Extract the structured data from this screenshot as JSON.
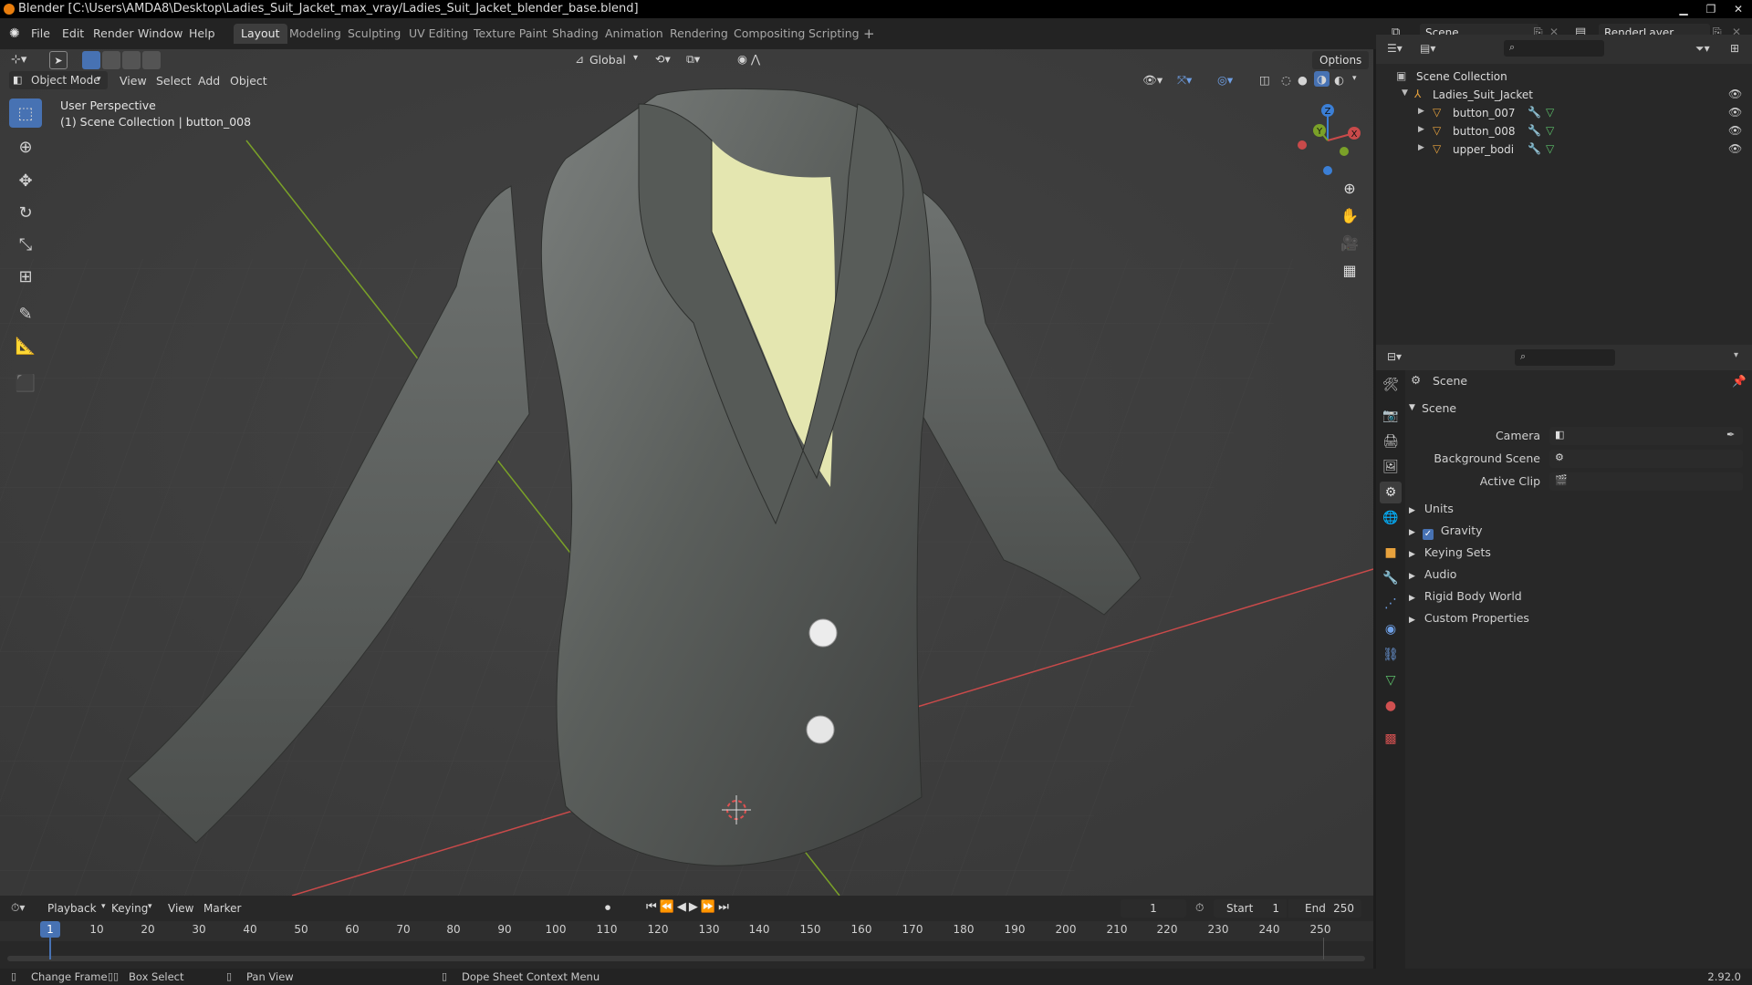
{
  "window": {
    "title": "Blender [C:\\Users\\AMDA8\\Desktop\\Ladies_Suit_Jacket_max_vray/Ladies_Suit_Jacket_blender_base.blend]"
  },
  "menu": {
    "items": [
      "File",
      "Edit",
      "Render",
      "Window",
      "Help"
    ]
  },
  "workspaces": [
    "Layout",
    "Modeling",
    "Sculpting",
    "UV Editing",
    "Texture Paint",
    "Shading",
    "Animation",
    "Rendering",
    "Compositing",
    "Scripting"
  ],
  "active_workspace": "Layout",
  "scene_selector": {
    "scene": "Scene",
    "render_layer": "RenderLayer"
  },
  "viewport_header": {
    "transform_orientation": "Global",
    "options_label": "Options",
    "mode": "Object Mode",
    "menus": [
      "View",
      "Select",
      "Add",
      "Object"
    ]
  },
  "viewport_overlay": {
    "line1": "User Perspective",
    "line2": "(1) Scene Collection | button_008"
  },
  "gizmo": {
    "z": "Z",
    "y": "Y",
    "x": "X"
  },
  "outliner": {
    "root": "Scene Collection",
    "collection": "Ladies_Suit_Jacket",
    "objects": [
      "button_007",
      "button_008",
      "upper_bodi"
    ]
  },
  "properties": {
    "context_title": "Scene",
    "panel_title": "Scene",
    "fields": [
      {
        "label": "Camera",
        "value": ""
      },
      {
        "label": "Background Scene",
        "value": ""
      },
      {
        "label": "Active Clip",
        "value": ""
      }
    ],
    "sections": [
      {
        "label": "Units",
        "checkbox": false
      },
      {
        "label": "Gravity",
        "checkbox": true
      },
      {
        "label": "Keying Sets",
        "checkbox": false
      },
      {
        "label": "Audio",
        "checkbox": false
      },
      {
        "label": "Rigid Body World",
        "checkbox": false
      },
      {
        "label": "Custom Properties",
        "checkbox": false
      }
    ]
  },
  "timeline": {
    "menus": [
      "Playback",
      "Keying",
      "View",
      "Marker"
    ],
    "current_frame": "1",
    "start_label": "Start",
    "start": "1",
    "end_label": "End",
    "end": "250",
    "ticks": [
      "1",
      "10",
      "20",
      "30",
      "40",
      "50",
      "60",
      "70",
      "80",
      "90",
      "100",
      "110",
      "120",
      "130",
      "140",
      "150",
      "160",
      "170",
      "180",
      "190",
      "200",
      "210",
      "220",
      "230",
      "240",
      "250"
    ]
  },
  "statusbar": {
    "change_frame": "Change Frame",
    "box_select": "Box Select",
    "pan_view": "Pan View",
    "context_menu": "Dope Sheet Context Menu",
    "version": "2.92.0"
  },
  "colors": {
    "accent": "#4772b3",
    "x_axis": "#c94a4a",
    "y_axis": "#7aa128",
    "z_axis": "#3b7fd6",
    "jacket": "#5f625f",
    "top": "#e4e6b0"
  }
}
